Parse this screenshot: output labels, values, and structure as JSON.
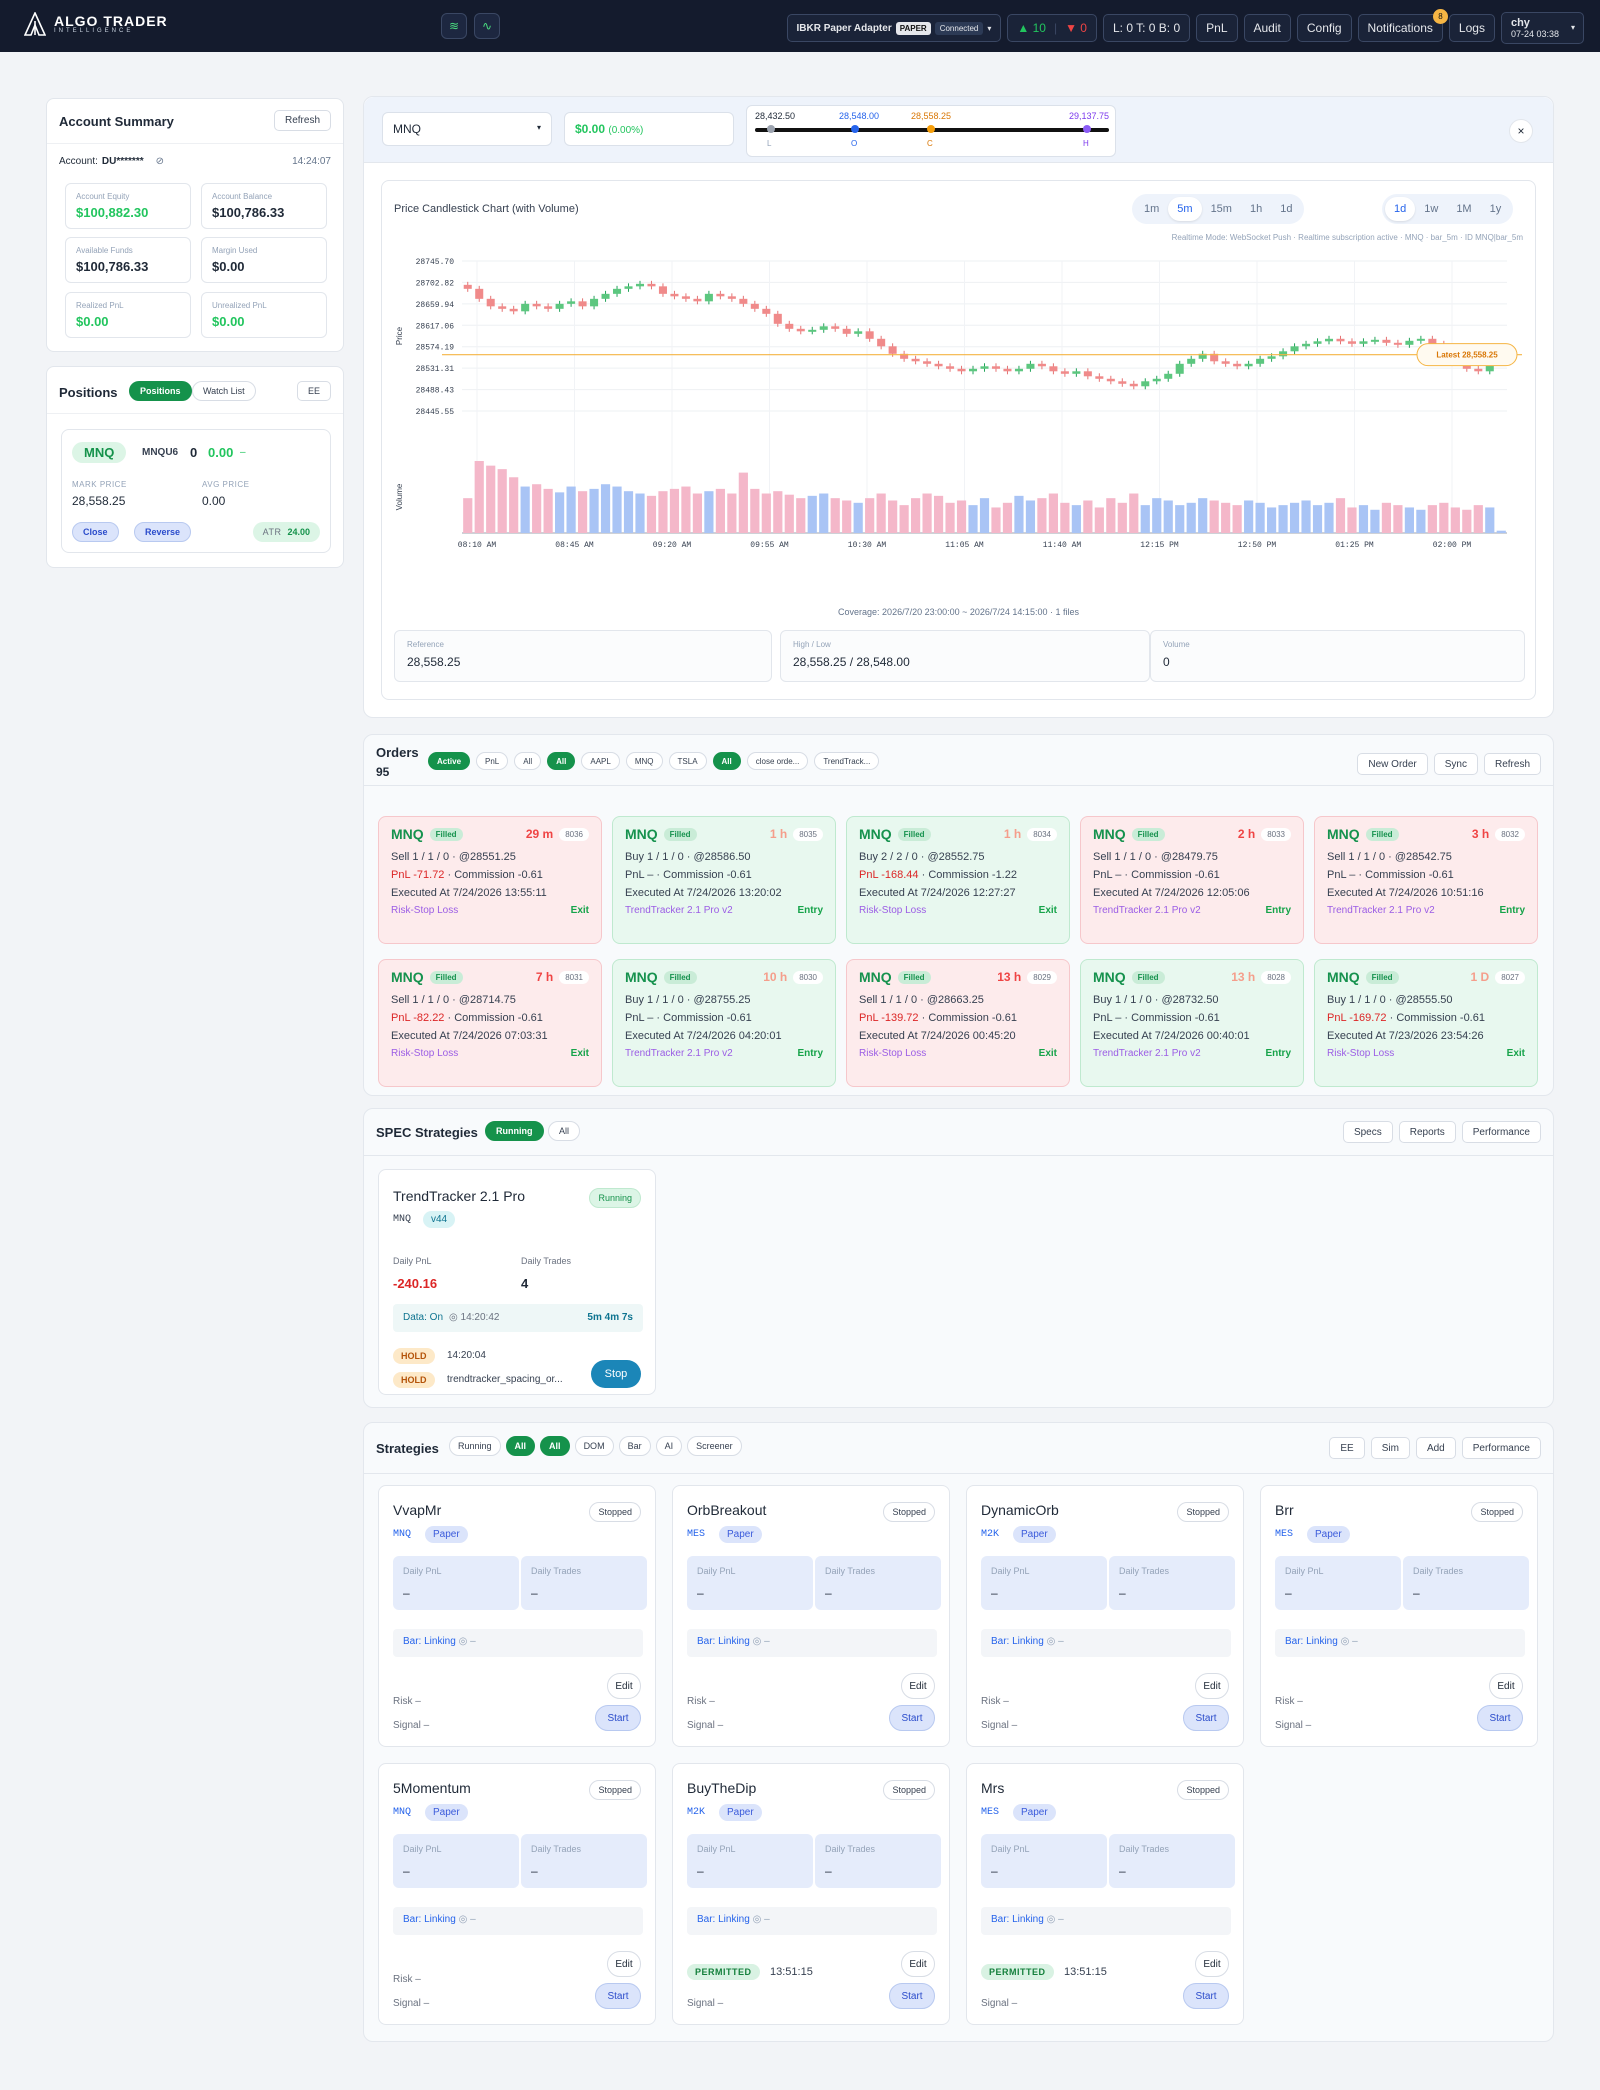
{
  "topbar": {
    "brand": "ALGO TRADER",
    "brand_sub": "INTELLIGENCE",
    "adapter": "IBKR Paper Adapter",
    "adapter_mode": "PAPER",
    "adapter_status": "Connected",
    "up_count": "▲ 10",
    "down_count": "▼ 0",
    "lob": "L: 0 T: 0 B: 0",
    "pnl": "PnL",
    "audit": "Audit",
    "config": "Config",
    "notifications": "Notifications",
    "notif_count": "8",
    "logs": "Logs",
    "user": "chy",
    "time": "07-24 03:38"
  },
  "account": {
    "title": "Account Summary",
    "refresh": "Refresh",
    "account_label": "Account:",
    "account_id": "DU*******",
    "time": "14:24:07",
    "boxes": [
      {
        "label": "Account Equity",
        "value": "$100,882.30",
        "green": true
      },
      {
        "label": "Account Balance",
        "value": "$100,786.33",
        "green": false
      },
      {
        "label": "Available Funds",
        "value": "$100,786.33",
        "green": false
      },
      {
        "label": "Margin Used",
        "value": "$0.00",
        "green": false
      },
      {
        "label": "Realized PnL",
        "value": "$0.00",
        "green": true
      },
      {
        "label": "Unrealized PnL",
        "value": "$0.00",
        "green": true
      }
    ]
  },
  "positions": {
    "title": "Positions",
    "tab_positions": "Positions",
    "tab_watch": "Watch List",
    "ee": "EE",
    "item": {
      "symbol": "MNQ",
      "contract": "MNQU6",
      "qty": "0",
      "pnl": "0.00",
      "pnl_suffix": "–",
      "mark_label": "MARK PRICE",
      "mark": "28,558.25",
      "avg_label": "AVG PRICE",
      "avg": "0.00",
      "close": "Close",
      "reverse": "Reverse",
      "atr_label": "ATR",
      "atr": "24.00"
    }
  },
  "chart_header": {
    "symbol": "MNQ",
    "change": "$0.00",
    "change_pct": "(0.00%)",
    "range_low": "28,432.50",
    "range_open": "28,548.00",
    "range_close": "28,558.25",
    "range_high": "29,137.75",
    "range_letters": [
      "L",
      "O",
      "C",
      "H"
    ],
    "close_x": "×"
  },
  "chart_panel": {
    "title": "Price Candlestick Chart (with Volume)",
    "tf_intraday": [
      "1m",
      "5m",
      "15m",
      "1h",
      "1d"
    ],
    "tf_intraday_active": "5m",
    "tf_range": [
      "1d",
      "1w",
      "1M",
      "1y"
    ],
    "tf_range_active": "1d",
    "realtime": "Realtime Mode: WebSocket Push · Realtime subscription active · MNQ · bar_5m · ID MNQ|bar_5m",
    "price_axis": "Price",
    "volume_axis": "Volume",
    "latest_label": "Latest 28,558.25",
    "coverage": "Coverage: 2026/7/20 23:00:00 ~ 2026/7/24 14:15:00 · 1 files",
    "ref_label": "Reference",
    "ref_value": "28,558.25",
    "hl_label": "High / Low",
    "hl_value": "28,558.25 / 28,548.00",
    "vol_label": "Volume",
    "vol_value": "0"
  },
  "chart_data": {
    "type": "candlestick",
    "y_ticks": [
      28745.7,
      28702.82,
      28659.94,
      28617.06,
      28574.19,
      28531.31,
      28488.43,
      28445.55
    ],
    "ylim": [
      28445.55,
      28745.7
    ],
    "x_ticks": [
      "08:10 AM",
      "08:45 AM",
      "09:20 AM",
      "09:55 AM",
      "10:30 AM",
      "11:05 AM",
      "11:40 AM",
      "12:15 PM",
      "12:50 PM",
      "01:25 PM",
      "02:00 PM"
    ],
    "latest": 28558.25,
    "close": [
      28690,
      28670,
      28655,
      28650,
      28645,
      28660,
      28655,
      28650,
      28660,
      28665,
      28655,
      28670,
      28680,
      28690,
      28695,
      28700,
      28695,
      28680,
      28675,
      28670,
      28665,
      28680,
      28675,
      28670,
      28660,
      28650,
      28640,
      28620,
      28610,
      28605,
      28608,
      28615,
      28610,
      28600,
      28605,
      28590,
      28575,
      28560,
      28550,
      28545,
      28540,
      28535,
      28530,
      28525,
      28530,
      28535,
      28530,
      28525,
      28530,
      28540,
      28535,
      28525,
      28520,
      28525,
      28515,
      28510,
      28505,
      28500,
      28495,
      28505,
      28510,
      28520,
      28540,
      28550,
      28560,
      28545,
      28540,
      28535,
      28540,
      28550,
      28555,
      28565,
      28575,
      28580,
      28585,
      28590,
      28585,
      28580,
      28585,
      28588,
      28582,
      28578,
      28586,
      28590,
      28580,
      28560,
      28545,
      28530,
      28525,
      28545,
      28558
    ],
    "volume": [
      30,
      62,
      58,
      55,
      48,
      40,
      42,
      38,
      35,
      40,
      36,
      38,
      42,
      40,
      36,
      34,
      32,
      36,
      38,
      40,
      34,
      36,
      38,
      34,
      52,
      38,
      34,
      36,
      33,
      30,
      32,
      34,
      30,
      28,
      26,
      30,
      34,
      28,
      24,
      30,
      34,
      32,
      26,
      28,
      24,
      30,
      22,
      26,
      32,
      28,
      30,
      34,
      26,
      24,
      28,
      22,
      30,
      26,
      34,
      24,
      30,
      28,
      24,
      26,
      30,
      28,
      26,
      24,
      28,
      26,
      22,
      24,
      26,
      28,
      24,
      26,
      30,
      22,
      24,
      20,
      26,
      24,
      22,
      20,
      24,
      26,
      22,
      20,
      24,
      22,
      2
    ]
  },
  "orders": {
    "title": "Orders",
    "count": "95",
    "filters1": [
      "Active",
      "PnL",
      "All",
      "All"
    ],
    "filters2": [
      "AAPL",
      "MNQ",
      "TSLA",
      "All",
      "close orde...",
      "TrendTrack..."
    ],
    "new_order": "New Order",
    "sync": "Sync",
    "refresh": "Refresh",
    "filled": "Filled",
    "commission_label": "Commission",
    "pnl_label": "PnL",
    "executed_label": "Executed At",
    "items": [
      {
        "sym": "MNQ",
        "age": "29 m",
        "id": "8036",
        "side": "Sell 1 / 1 / 0",
        "price": "@28551.25",
        "pnl": "-71.72",
        "comm": "-0.61",
        "exec": "7/24/2026 13:55:11",
        "src": "Risk-Stop Loss",
        "type": "Exit",
        "tone": "red"
      },
      {
        "sym": "MNQ",
        "age": "1 h",
        "id": "8035",
        "side": "Buy 1 / 1 / 0",
        "price": "@28586.50",
        "pnl": "–",
        "comm": "-0.61",
        "exec": "7/24/2026 13:20:02",
        "src": "TrendTracker 2.1 Pro v2",
        "type": "Entry",
        "tone": "grn"
      },
      {
        "sym": "MNQ",
        "age": "1 h",
        "id": "8034",
        "side": "Buy 2 / 2 / 0",
        "price": "@28552.75",
        "pnl": "-168.44",
        "comm": "-1.22",
        "exec": "7/24/2026 12:27:27",
        "src": "Risk-Stop Loss",
        "type": "Exit",
        "tone": "grn"
      },
      {
        "sym": "MNQ",
        "age": "2 h",
        "id": "8033",
        "side": "Sell 1 / 1 / 0",
        "price": "@28479.75",
        "pnl": "–",
        "comm": "-0.61",
        "exec": "7/24/2026 12:05:06",
        "src": "TrendTracker 2.1 Pro v2",
        "type": "Entry",
        "tone": "red"
      },
      {
        "sym": "MNQ",
        "age": "3 h",
        "id": "8032",
        "side": "Sell 1 / 1 / 0",
        "price": "@28542.75",
        "pnl": "–",
        "comm": "-0.61",
        "exec": "7/24/2026 10:51:16",
        "src": "TrendTracker 2.1 Pro v2",
        "type": "Entry",
        "tone": "red"
      },
      {
        "sym": "MNQ",
        "age": "7 h",
        "id": "8031",
        "side": "Sell 1 / 1 / 0",
        "price": "@28714.75",
        "pnl": "-82.22",
        "comm": "-0.61",
        "exec": "7/24/2026 07:03:31",
        "src": "Risk-Stop Loss",
        "type": "Exit",
        "tone": "red"
      },
      {
        "sym": "MNQ",
        "age": "10 h",
        "id": "8030",
        "side": "Buy 1 / 1 / 0",
        "price": "@28755.25",
        "pnl": "–",
        "comm": "-0.61",
        "exec": "7/24/2026 04:20:01",
        "src": "TrendTracker 2.1 Pro v2",
        "type": "Entry",
        "tone": "grn"
      },
      {
        "sym": "MNQ",
        "age": "13 h",
        "id": "8029",
        "side": "Sell 1 / 1 / 0",
        "price": "@28663.25",
        "pnl": "-139.72",
        "comm": "-0.61",
        "exec": "7/24/2026 00:45:20",
        "src": "Risk-Stop Loss",
        "type": "Exit",
        "tone": "red"
      },
      {
        "sym": "MNQ",
        "age": "13 h",
        "id": "8028",
        "side": "Buy 1 / 1 / 0",
        "price": "@28732.50",
        "pnl": "–",
        "comm": "-0.61",
        "exec": "7/24/2026 00:40:01",
        "src": "TrendTracker 2.1 Pro v2",
        "type": "Entry",
        "tone": "grn"
      },
      {
        "sym": "MNQ",
        "age": "1 D",
        "id": "8027",
        "side": "Buy 1 / 1 / 0",
        "price": "@28555.50",
        "pnl": "-169.72",
        "comm": "-0.61",
        "exec": "7/23/2026 23:54:26",
        "src": "Risk-Stop Loss",
        "type": "Exit",
        "tone": "grn"
      }
    ]
  },
  "spec": {
    "title": "SPEC Strategies",
    "running": "Running",
    "all": "All",
    "specs": "Specs",
    "reports": "Reports",
    "performance": "Performance",
    "card": {
      "name": "TrendTracker 2.1 Pro",
      "status": "Running",
      "symbol": "MNQ",
      "version": "v44",
      "pnl_label": "Daily PnL",
      "pnl": "-240.16",
      "trades_label": "Daily Trades",
      "trades": "4",
      "data": "Data: On",
      "data_time": "◎ 14:20:42",
      "uptime": "5m 4m 7s",
      "hold1": "HOLD",
      "hold1_text": "14:20:04",
      "hold2": "HOLD",
      "hold2_text": "trendtracker_spacing_or...",
      "stop": "Stop"
    }
  },
  "strategies": {
    "title": "Strategies",
    "filters": [
      "Running",
      "All",
      "All",
      "DOM",
      "Bar",
      "AI",
      "Screener"
    ],
    "ee": "EE",
    "sim": "Sim",
    "add": "Add",
    "performance": "Performance",
    "pnl_label": "Daily PnL",
    "trades_label": "Daily Trades",
    "dash": "–",
    "bar": "Bar: Linking",
    "bar_suffix": "◎ –",
    "edit": "Edit",
    "start": "Start",
    "risk": "Risk –",
    "signal": "Signal –",
    "paper": "Paper",
    "stopped": "Stopped",
    "items": [
      {
        "name": "VvapMr",
        "symbol": "MNQ",
        "permitted": "",
        "ptime": ""
      },
      {
        "name": "OrbBreakout",
        "symbol": "MES",
        "permitted": "",
        "ptime": ""
      },
      {
        "name": "DynamicOrb",
        "symbol": "M2K",
        "permitted": "",
        "ptime": ""
      },
      {
        "name": "Brr",
        "symbol": "MES",
        "permitted": "",
        "ptime": ""
      },
      {
        "name": "5Momentum",
        "symbol": "MNQ",
        "permitted": "",
        "ptime": ""
      },
      {
        "name": "BuyTheDip",
        "symbol": "M2K",
        "permitted": "PERMITTED",
        "ptime": "13:51:15"
      },
      {
        "name": "Mrs",
        "symbol": "MES",
        "permitted": "PERMITTED",
        "ptime": "13:51:15"
      }
    ]
  }
}
